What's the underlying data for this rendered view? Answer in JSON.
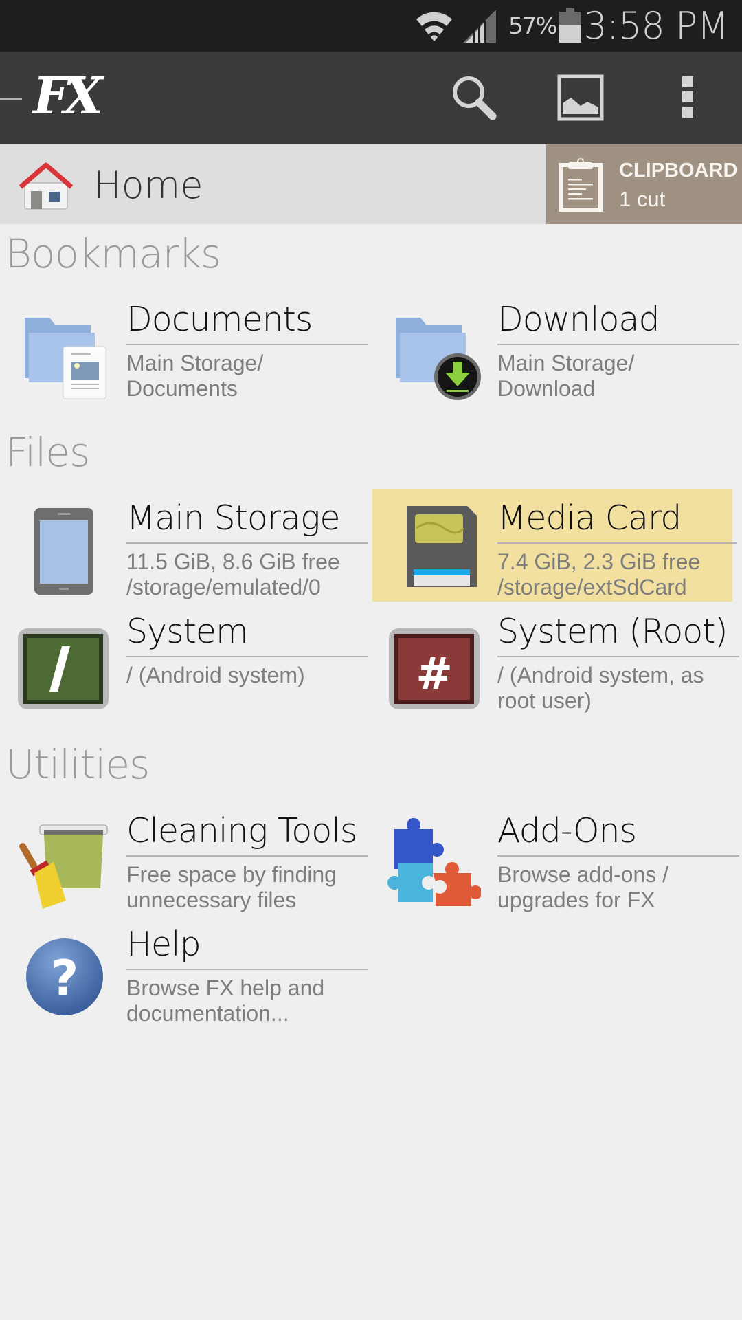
{
  "status_bar": {
    "wifi_icon": "wifi-icon",
    "signal_icon": "cell-signal-icon",
    "battery_percent": "57%",
    "battery_icon": "battery-icon",
    "time": "3:58 PM"
  },
  "toolbar": {
    "app_logo": "FX",
    "nav_icon": "drawer-indicator-icon",
    "actions": [
      {
        "name": "search",
        "icon": "search-icon"
      },
      {
        "name": "media",
        "icon": "image-icon"
      },
      {
        "name": "overflow",
        "icon": "overflow-menu-icon"
      }
    ]
  },
  "breadcrumb": {
    "icon": "home-icon",
    "label": "Home"
  },
  "clipboard": {
    "icon": "clipboard-icon",
    "title": "CLIPBOARD",
    "status": "1 cut",
    "color": "#a09282"
  },
  "sections": [
    {
      "title": "Bookmarks",
      "items": [
        {
          "title": "Documents",
          "subtitle": "Main Storage/\nDocuments",
          "icon": "documents-folder-icon"
        },
        {
          "title": "Download",
          "subtitle": "Main Storage/\nDownload",
          "icon": "download-folder-icon"
        }
      ]
    },
    {
      "title": "Files",
      "items": [
        {
          "title": "Main Storage",
          "subtitle": "11.5 GiB, 8.6 GiB free\n/storage/emulated/0",
          "icon": "tablet-storage-icon"
        },
        {
          "title": "Media Card",
          "subtitle": "7.4 GiB, 2.3 GiB free\n/storage/extSdCard",
          "icon": "sd-card-icon",
          "highlighted": true
        },
        {
          "title": "System",
          "subtitle": "/ (Android system)",
          "icon": "system-terminal-icon"
        },
        {
          "title": "System (Root)",
          "subtitle": "/ (Android system, as\nroot user)",
          "icon": "root-terminal-icon"
        }
      ]
    },
    {
      "title": "Utilities",
      "items": [
        {
          "title": "Cleaning Tools",
          "subtitle": "Free space by finding\nunnecessary files",
          "icon": "cleaning-broom-icon"
        },
        {
          "title": "Add-Ons",
          "subtitle": "Browse add-ons /\nupgrades for FX",
          "icon": "puzzle-addons-icon"
        },
        {
          "title": "Help",
          "subtitle": "Browse FX help and\ndocumentation...",
          "icon": "help-question-icon"
        }
      ]
    }
  ],
  "colors": {
    "status_bar_bg": "#1e1e1e",
    "toolbar_bg": "#3a3a3a",
    "breadcrumb_bg": "#dedede",
    "content_bg": "#efefef",
    "highlight_bg": "#f2e0a0"
  }
}
